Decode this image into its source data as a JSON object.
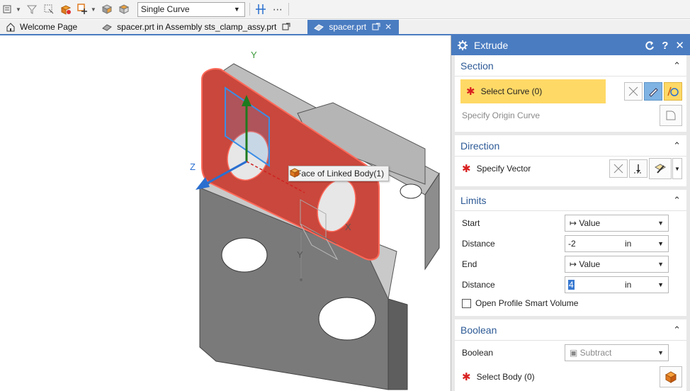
{
  "toolbar": {
    "selection_filter_value": "Single Curve",
    "more_label": "⋯",
    "icons": [
      "menu-icon",
      "filter-icon",
      "select-icon",
      "orient-icon",
      "snap-icon",
      "shaded-cube-icon",
      "wireframe-cube-icon",
      "snap-point-icon"
    ]
  },
  "tabs": [
    {
      "label": "Welcome Page"
    },
    {
      "label": "spacer.prt in Assembly sts_clamp_assy.prt"
    },
    {
      "label": "spacer.prt",
      "active": true
    }
  ],
  "viewport": {
    "axis_labels": {
      "y_top": "Y",
      "z": "Z",
      "x": "X",
      "y_bottom": "Y"
    },
    "tooltip": "Face of Linked Body(1)",
    "colors": {
      "face": "#c9473c",
      "body": "#8a8a8a",
      "selection": "#3b8ee6"
    }
  },
  "dialog": {
    "title": "Extrude",
    "section": {
      "title": "Section",
      "select_curve": "Select Curve (0)",
      "specify_origin": "Specify Origin Curve"
    },
    "direction": {
      "title": "Direction",
      "specify_vector": "Specify Vector"
    },
    "limits": {
      "title": "Limits",
      "start_label": "Start",
      "start_value": "Value",
      "distance1_label": "Distance",
      "distance1_value": "-2",
      "distance1_unit": "in",
      "end_label": "End",
      "end_value": "Value",
      "distance2_label": "Distance",
      "distance2_value": "4",
      "distance2_unit": "in",
      "open_profile": "Open Profile Smart Volume"
    },
    "boolean": {
      "title": "Boolean",
      "boolean_label": "Boolean",
      "boolean_value": "Subtract",
      "select_body": "Select Body (0)"
    }
  }
}
